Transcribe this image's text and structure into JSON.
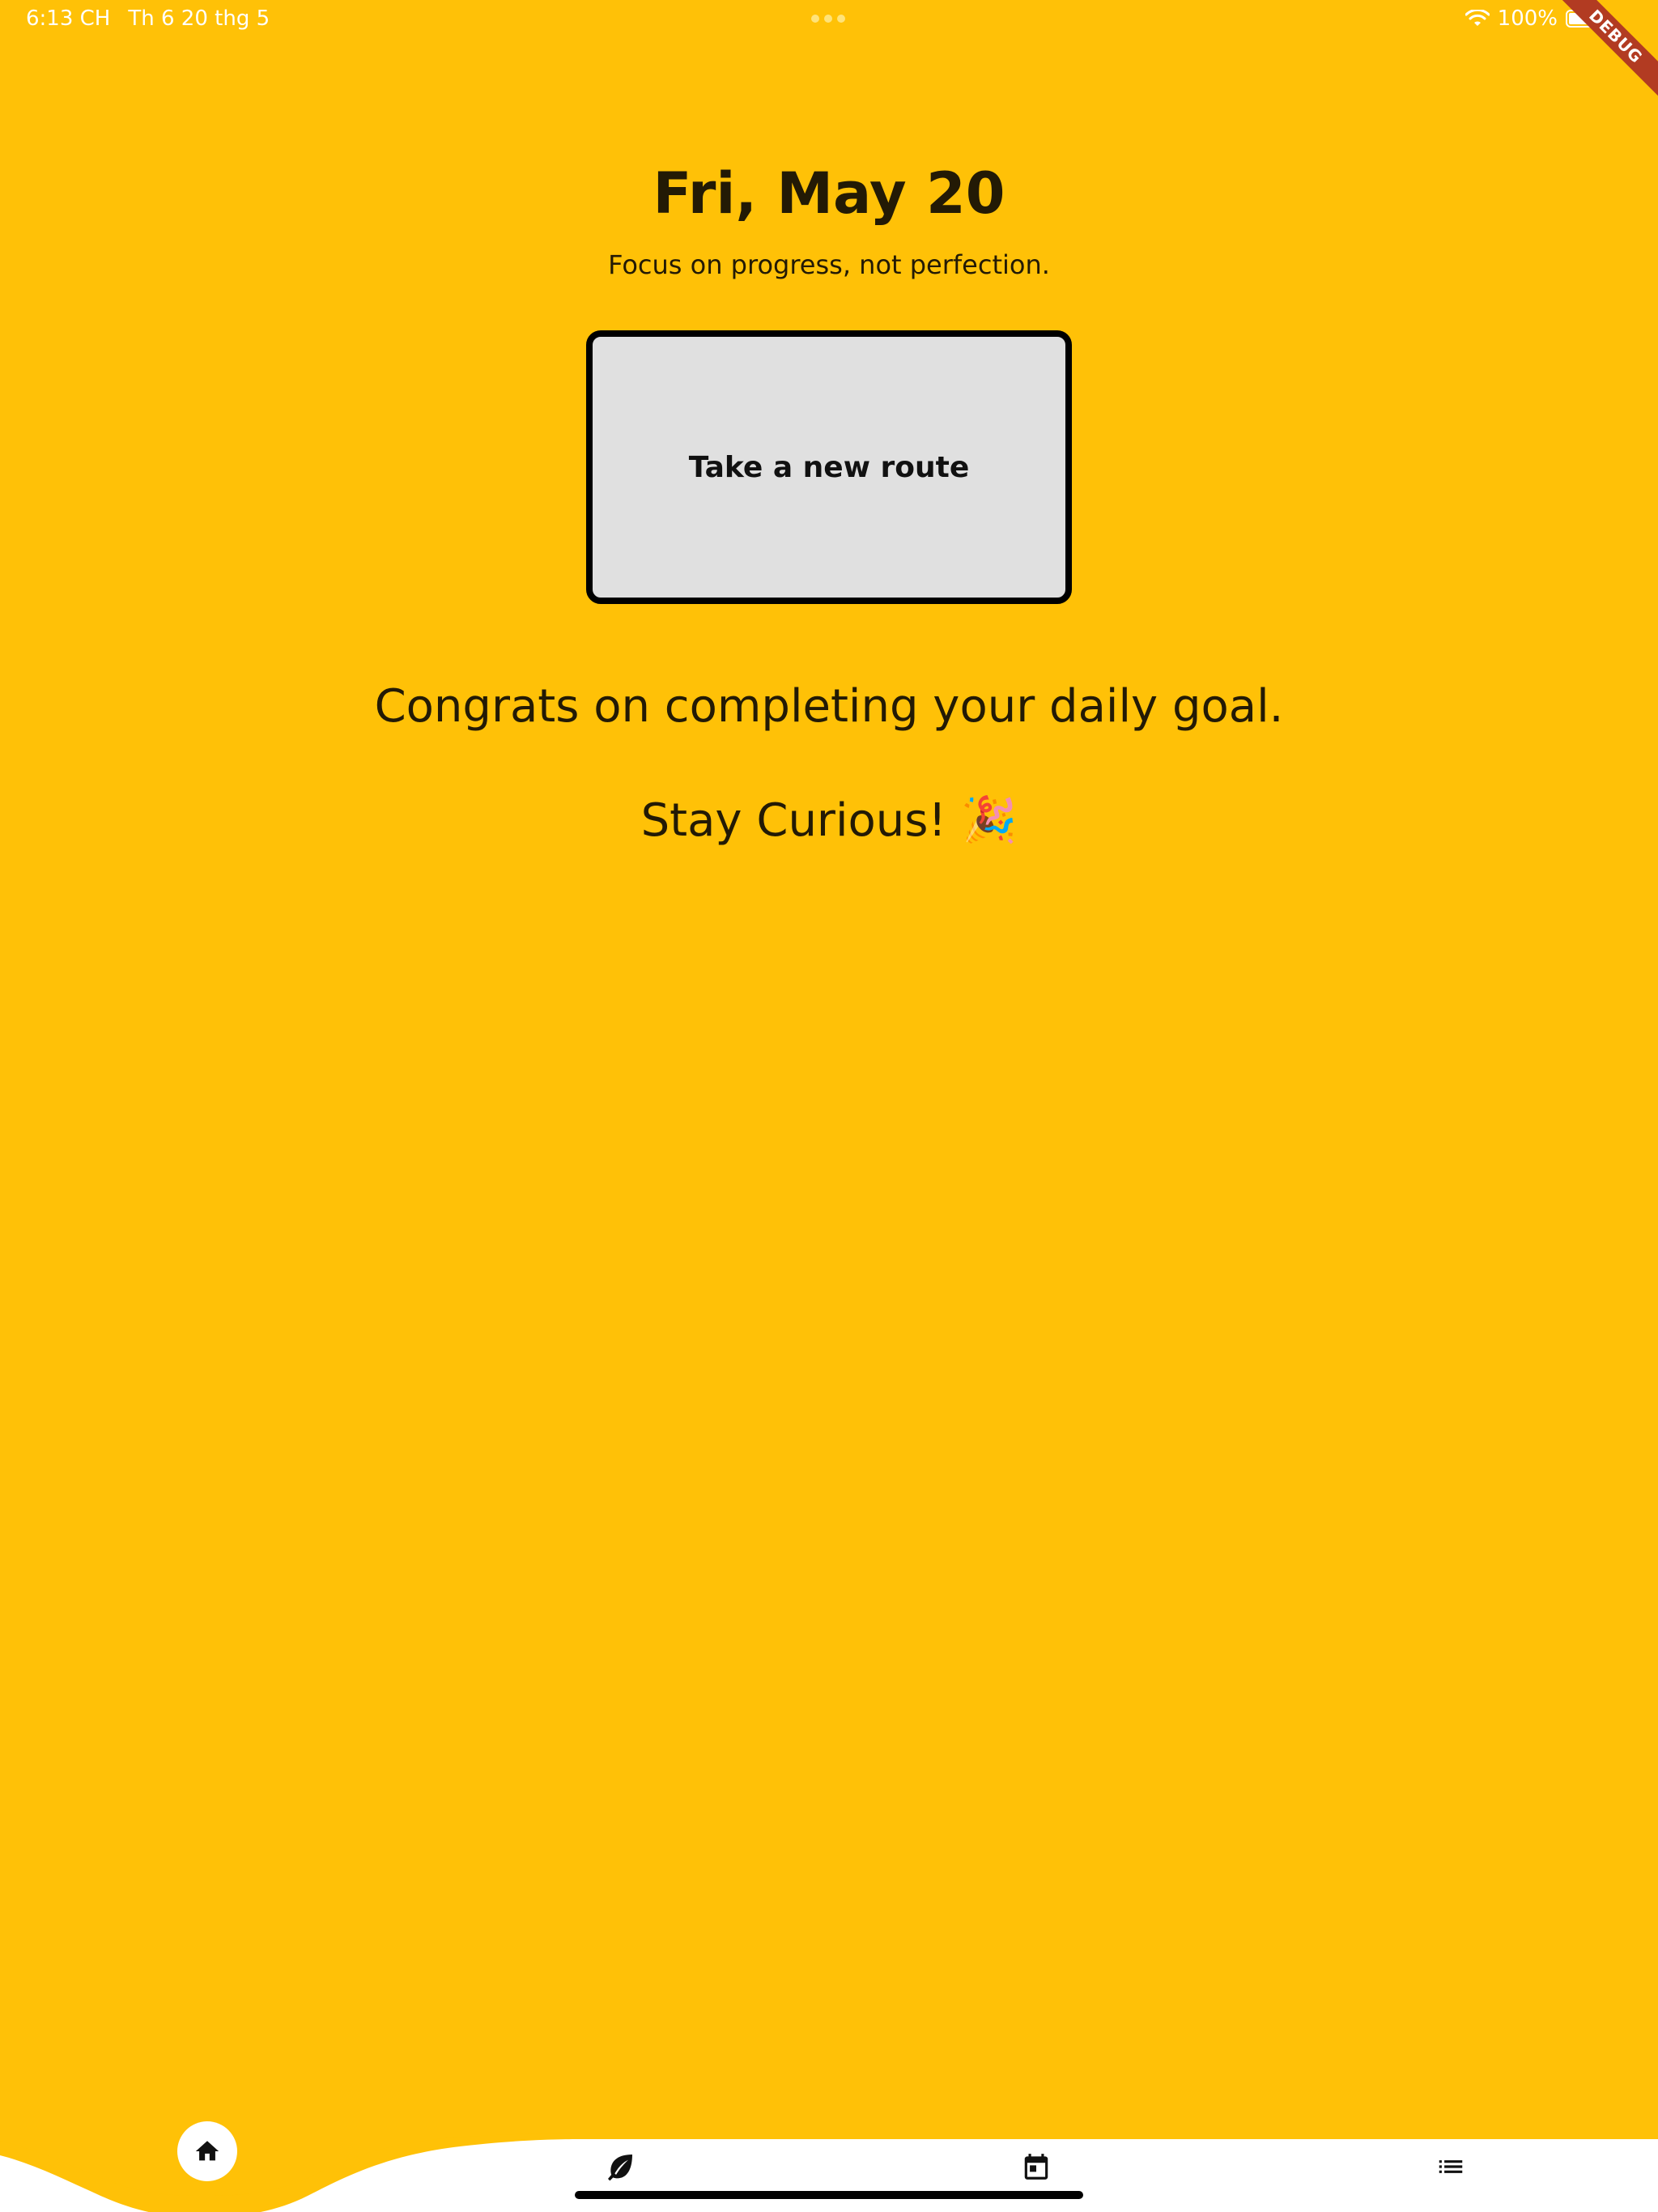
{
  "status_bar": {
    "time": "6:13 CH",
    "date": "Th 6 20 thg 5",
    "battery": "100%"
  },
  "debug_banner": "DEBUG",
  "main": {
    "date_title": "Fri, May 20",
    "subtitle": "Focus on progress, not perfection.",
    "route_button_label": "Take a new route",
    "congrats_message": "Congrats on completing your daily goal.",
    "closing_message": "Stay Curious! 🎉"
  },
  "bottom_nav": {
    "items": [
      {
        "icon": "home-icon",
        "active": true
      },
      {
        "icon": "leaf-icon",
        "active": false
      },
      {
        "icon": "calendar-icon",
        "active": false
      },
      {
        "icon": "list-icon",
        "active": false
      }
    ]
  },
  "colors": {
    "background": "#FFC107",
    "card": "#E0E0E0",
    "nav_background": "#FFFFFF",
    "debug_ribbon": "#B23B22"
  }
}
